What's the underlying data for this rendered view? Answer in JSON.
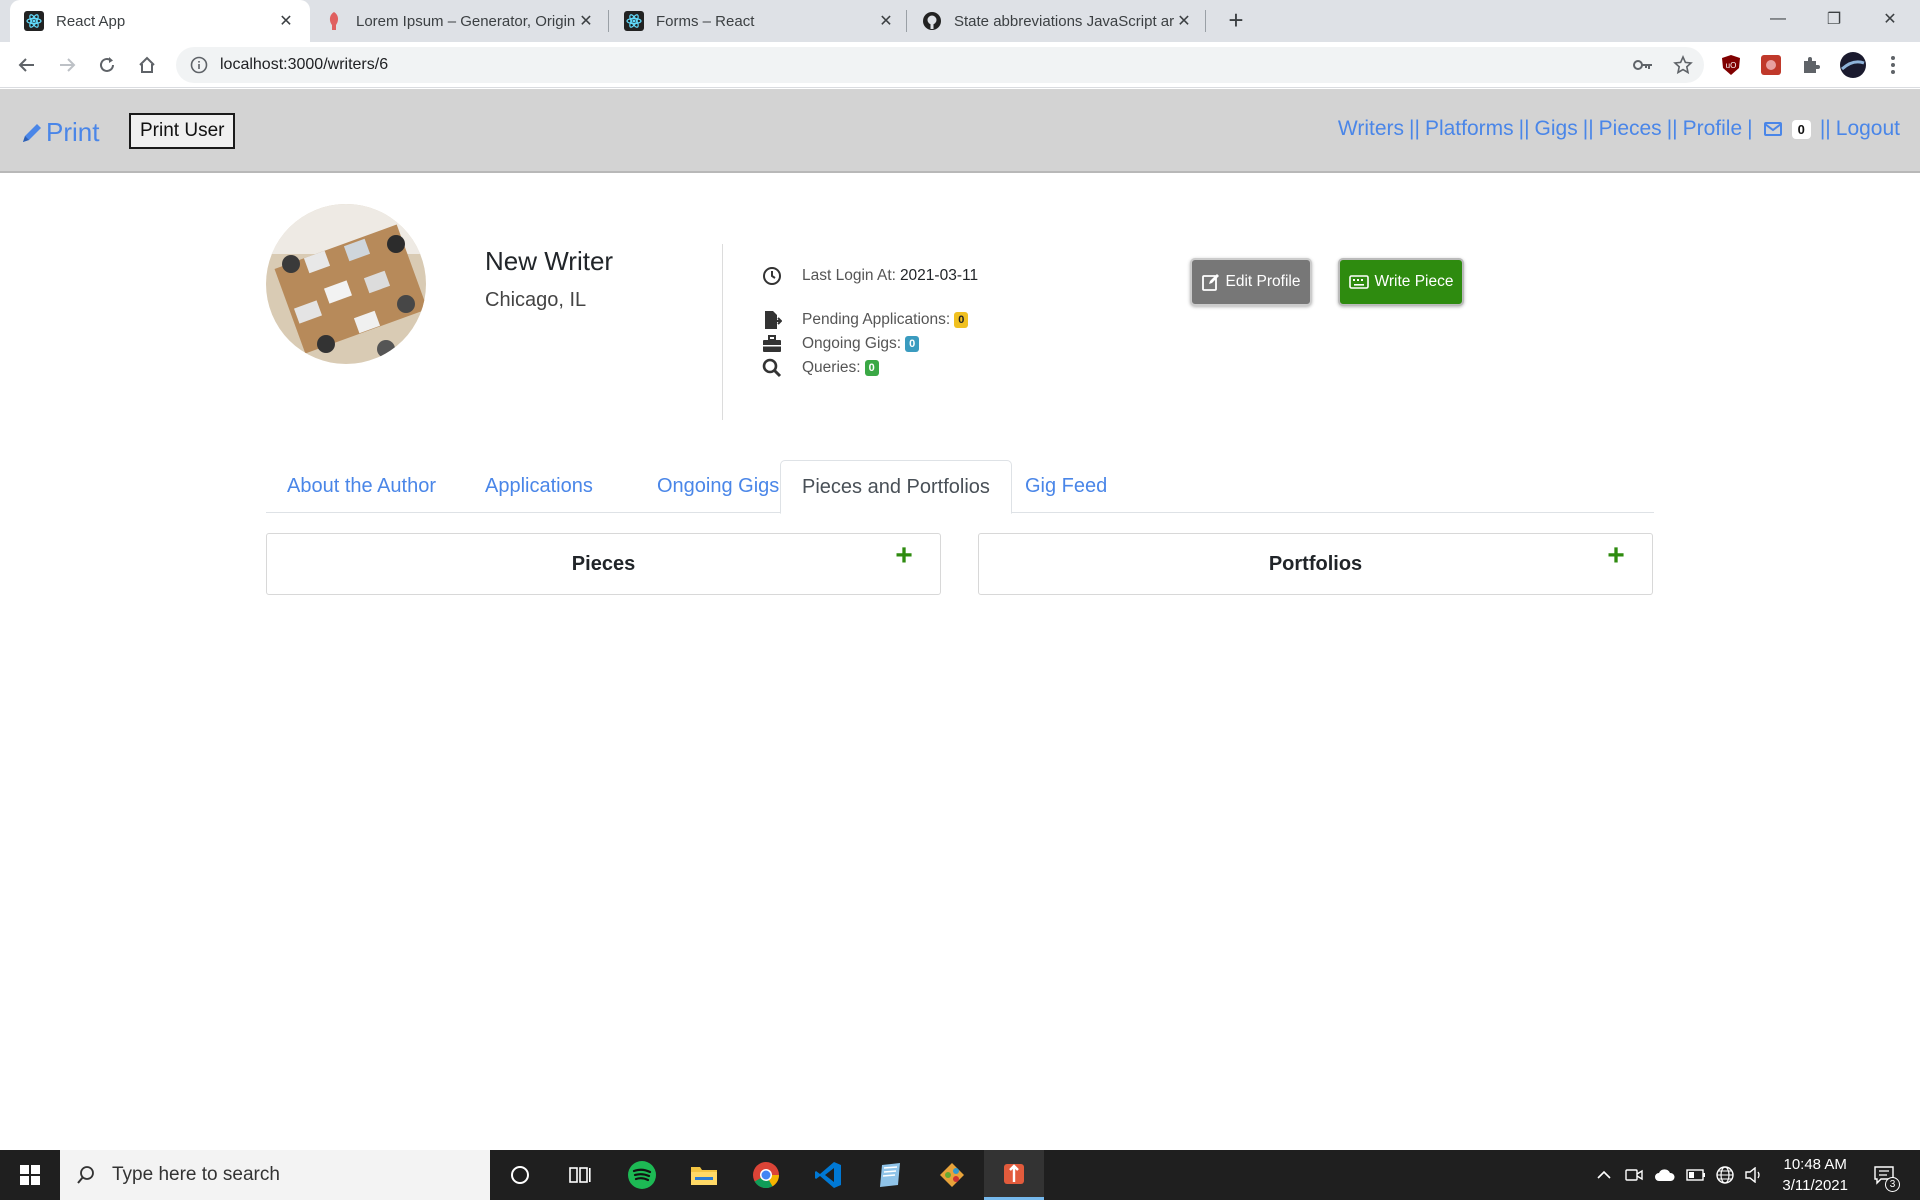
{
  "browser": {
    "tabs": [
      {
        "title": "React App"
      },
      {
        "title": "Lorem Ipsum – Generator, Origin"
      },
      {
        "title": "Forms – React"
      },
      {
        "title": "State abbreviations JavaScript ar"
      }
    ],
    "url": "localhost:3000/writers/6"
  },
  "navbar": {
    "brand": "Print",
    "print_user": "Print User",
    "links": [
      "Writers",
      "Platforms",
      "Gigs",
      "Pieces",
      "Profile"
    ],
    "separator": "||",
    "single_sep": "|",
    "message_count": "0",
    "logout": "Logout"
  },
  "profile": {
    "name": "New Writer",
    "location": "Chicago, IL",
    "last_login_label": "Last Login At:",
    "last_login_value": "2021-03-11",
    "pending_label": "Pending Applications:",
    "pending_count": "0",
    "ongoing_label": "Ongoing Gigs:",
    "ongoing_count": "0",
    "queries_label": "Queries:",
    "queries_count": "0",
    "edit_button": "Edit Profile",
    "write_button": "Write Piece"
  },
  "tabs": {
    "items": [
      "About the Author",
      "Applications",
      "Ongoing Gigs",
      "Pieces and Portfolios",
      "Gig Feed"
    ],
    "active": "Pieces and Portfolios"
  },
  "cards": {
    "pieces": "Pieces",
    "portfolios": "Portfolios"
  },
  "taskbar": {
    "search_placeholder": "Type here to search",
    "time": "10:48 AM",
    "date": "3/11/2021",
    "notification_count": "3"
  },
  "colors": {
    "link": "#4a86e8",
    "navbar_bg": "#d3d3d3",
    "success": "#2e8b0f",
    "pending_badge": "#f0c020",
    "ongoing_badge": "#3a9bbf",
    "queries_badge": "#3aa845"
  }
}
